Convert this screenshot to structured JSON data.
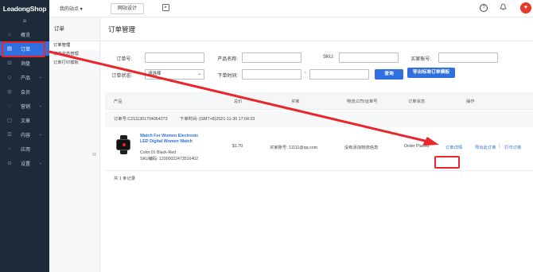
{
  "brand": {
    "logo": "LeadongShop"
  },
  "sidenav": {
    "collapse_glyph": "≡",
    "items": [
      {
        "label": "概览",
        "icon": "home-icon"
      },
      {
        "label": "订单",
        "icon": "order-icon",
        "active": true
      },
      {
        "label": "询盘",
        "icon": "inquiry-icon"
      },
      {
        "label": "产品",
        "icon": "product-icon",
        "chevron": "⌄"
      },
      {
        "label": "会员",
        "icon": "member-icon"
      },
      {
        "label": "营销",
        "icon": "marketing-icon",
        "chevron": "⌄"
      },
      {
        "label": "文章",
        "icon": "article-icon"
      },
      {
        "label": "内容",
        "icon": "content-icon",
        "chevron": "⌄"
      },
      {
        "label": "应用",
        "icon": "apps-icon"
      },
      {
        "label": "设置",
        "icon": "settings-icon",
        "chevron": "⌄"
      }
    ]
  },
  "topbar": {
    "site_select": "我的站点 ▾",
    "design_button": "网站设计",
    "help_glyph": "?",
    "bell_glyph": "🔔",
    "avatar_glyph": "♥"
  },
  "submenu": {
    "title": "订单",
    "items": [
      "订单管理",
      "订单状态管理",
      "订单打印模板"
    ],
    "collapse_glyph": "⊞"
  },
  "main": {
    "title": "订单管理",
    "filters": {
      "order_no_label": "订单号:",
      "product_name_label": "产品名称:",
      "sku_label": "SKU:",
      "buyer_account_label": "买家账号:",
      "status_label": "订单状态:",
      "status_value": "请选择",
      "order_time_label": "下单时间:",
      "range_sep": "~",
      "query_button": "查询",
      "export_button": "导出标准订单模板"
    },
    "table": {
      "headers": [
        "产品",
        "总价",
        "买家",
        "物流公司/运单号",
        "订单状态",
        "操作"
      ]
    },
    "order": {
      "order_no": "订单号:C211130170406427​3",
      "order_time": "下单时间: (GMT+8)2021-11-30 17:04:33",
      "product_name": "Watch For Women Electronic LED Digital Women Watch",
      "color": "Color:01 Black-Red",
      "sku": "SKU编码: 12000022473516402",
      "price": "$1.70",
      "buyer": "买家账号: 11111@qq.com",
      "logistics": "没有添加物流信息",
      "status": "Order Placed",
      "op_detail": "订单详情",
      "op_export": "导出此订单",
      "op_sep": "|",
      "op_print": "打印订单"
    },
    "total": "共 1 条记录"
  },
  "colors": {
    "accent": "#2f6fe0",
    "nav_bg": "#1c2a3a",
    "annotation_red": "#e8262b"
  }
}
